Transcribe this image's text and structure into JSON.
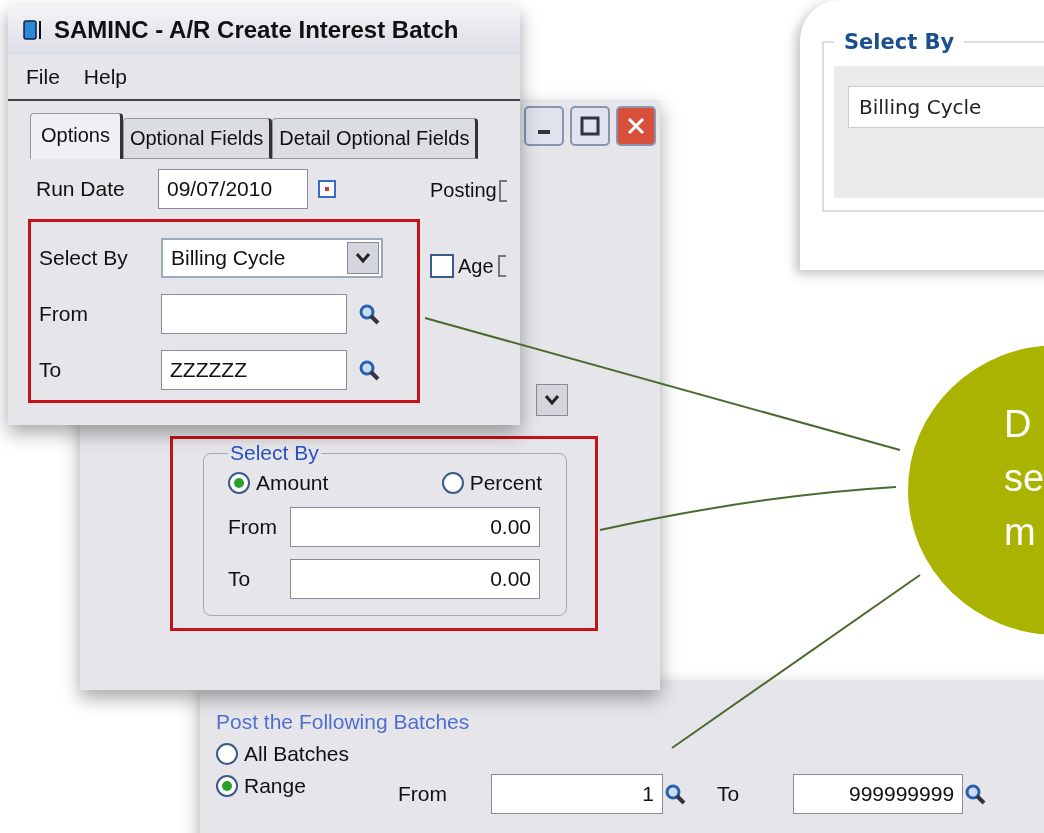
{
  "main_window": {
    "title": "SAMINC - A/R Create Interest Batch",
    "menu": [
      {
        "label": "File"
      },
      {
        "label": "Help"
      }
    ],
    "tabs": [
      {
        "label": "Options",
        "selected": true
      },
      {
        "label": "Optional Fields",
        "selected": false
      },
      {
        "label": "Detail Optional Fields",
        "selected": false
      }
    ],
    "run_date": {
      "label": "Run Date",
      "value": "09/07/2010"
    },
    "select_by": {
      "label": "Select By",
      "value": "Billing Cycle"
    },
    "from": {
      "label": "From"
    },
    "to": {
      "label": "To",
      "value": "ZZZZZZ"
    },
    "posting_label": "Posting",
    "age": {
      "label": "Age",
      "checked": false
    }
  },
  "back_window": {
    "amount_group": {
      "legend": "Select By",
      "options": [
        {
          "label": "Amount",
          "selected": true
        },
        {
          "label": "Percent",
          "selected": false
        }
      ],
      "from": {
        "label": "From",
        "value": "0.00"
      },
      "to": {
        "label": "To",
        "value": "0.00"
      }
    }
  },
  "batches_panel": {
    "heading": "Post the Following Batches",
    "options": [
      {
        "label": "All Batches",
        "selected": false
      },
      {
        "label": "Range",
        "selected": true
      }
    ],
    "from": {
      "label": "From",
      "value": "1"
    },
    "to": {
      "label": "To",
      "value": "999999999"
    }
  },
  "web_card": {
    "legend": "Select By",
    "value": "Billing Cycle"
  },
  "callout": {
    "lines": [
      "D",
      "se",
      "m"
    ]
  }
}
